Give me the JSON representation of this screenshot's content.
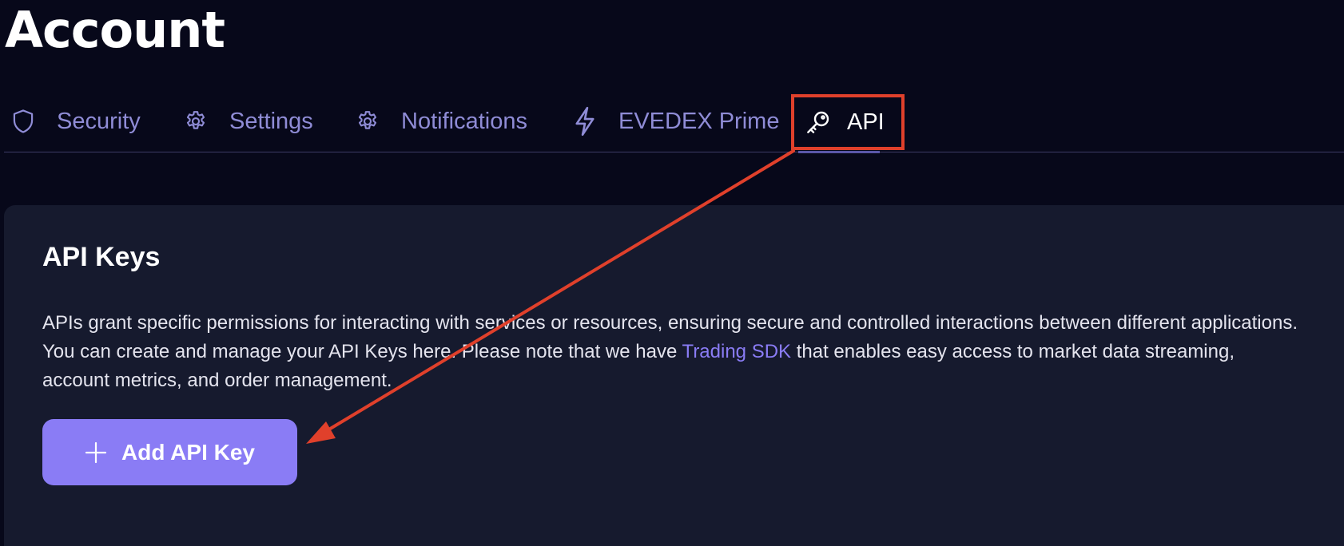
{
  "page": {
    "title": "Account"
  },
  "tabs": [
    {
      "label": "Security",
      "icon": "shield-icon",
      "active": false
    },
    {
      "label": "Settings",
      "icon": "gear-icon",
      "active": false
    },
    {
      "label": "Notifications",
      "icon": "gear-icon",
      "active": false
    },
    {
      "label": "EVEDEX Prime",
      "icon": "lightning-icon",
      "active": false
    },
    {
      "label": "API",
      "icon": "key-icon",
      "active": true
    }
  ],
  "api_card": {
    "title": "API Keys",
    "description_before_link": "APIs grant specific permissions for interacting with services or resources, ensuring secure and controlled interactions between different applications. You can create and manage your API Keys here. Please note that we have ",
    "link_text": "Trading SDK",
    "description_after_link": " that enables easy access to market data streaming, account metrics, and order management.",
    "add_button_label": "Add API Key",
    "add_button_icon": "plus-icon"
  },
  "annotation": {
    "highlight_color": "#e0402b",
    "highlighted_element": "tab-api",
    "arrow_target": "add-api-key-button"
  },
  "colors": {
    "background": "#07081a",
    "card_background": "#161a2e",
    "accent": "#8a7cf5",
    "tab_inactive": "#8f8cd6",
    "text_primary": "#ffffff"
  }
}
